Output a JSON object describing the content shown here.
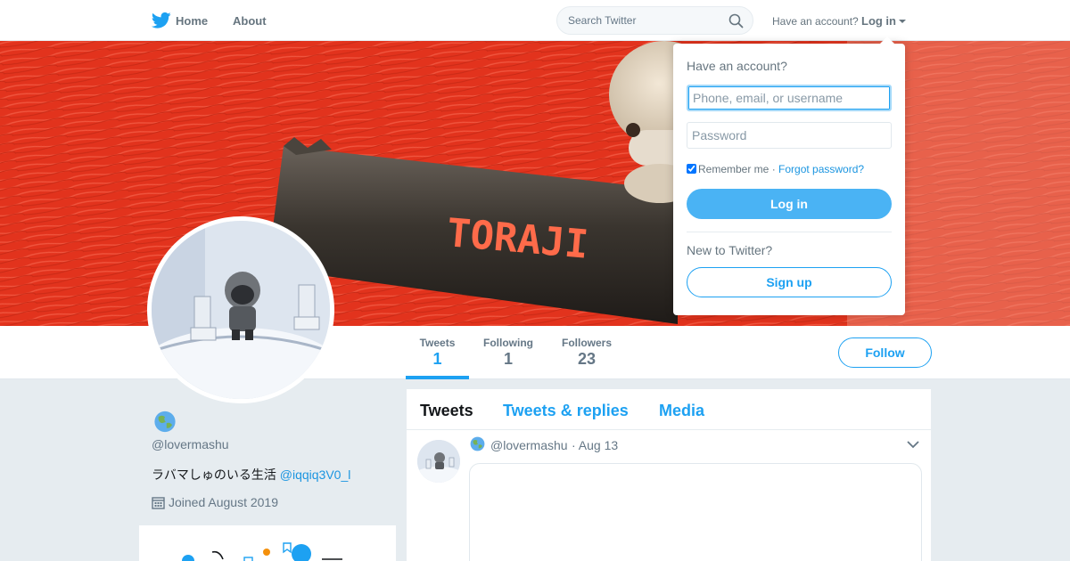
{
  "nav": {
    "home_label": "Home",
    "about_label": "About",
    "search_placeholder": "Search Twitter",
    "have_account": "Have an account?",
    "login_label": "Log in"
  },
  "banner": {
    "package_text": "TORAJI",
    "background_color": "#e2331d"
  },
  "profile": {
    "handle": "@lovermashu",
    "bio_text": "ラバマしゅのいる生活 ",
    "bio_link": "@iqqiq3V0_l",
    "joined": "Joined August 2019"
  },
  "stats": {
    "tweets_label": "Tweets",
    "tweets_value": "1",
    "following_label": "Following",
    "following_value": "1",
    "followers_label": "Followers",
    "followers_value": "23"
  },
  "follow_button": "Follow",
  "timeline": {
    "tabs": [
      "Tweets",
      "Tweets & replies",
      "Media"
    ],
    "tweet": {
      "handle": "@lovermashu",
      "date": "· Aug 13"
    }
  },
  "login_dropdown": {
    "title": "Have an account?",
    "username_placeholder": "Phone, email, or username",
    "password_placeholder": "Password",
    "remember_label": "Remember me",
    "separator": " · ",
    "forgot_label": "Forgot password?",
    "login_button": "Log in",
    "new_label": "New to Twitter?",
    "signup_button": "Sign up"
  },
  "colors": {
    "accent": "#1da1f2",
    "login_button_bg": "#4ab3f4",
    "page_bg": "#e6ecf0"
  }
}
